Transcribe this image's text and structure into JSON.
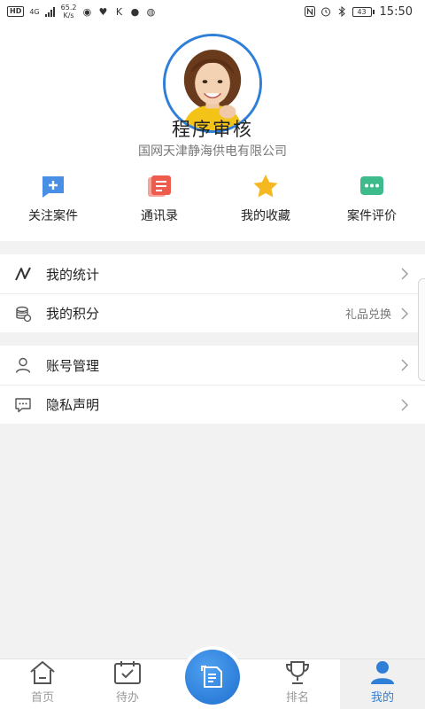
{
  "status_bar": {
    "left_chip": "HD",
    "network": "4G",
    "speed_value": "65.2",
    "speed_unit": "K/s",
    "battery": "43",
    "time": "15:50"
  },
  "profile": {
    "name": "程序审核",
    "company": "国网天津静海供电有限公司"
  },
  "quick_actions": [
    {
      "label": "关注案件",
      "icon": "bookmark-plus-icon",
      "color": "#4a8fe6"
    },
    {
      "label": "通讯录",
      "icon": "contacts-book-icon",
      "color": "#ee5c4d"
    },
    {
      "label": "我的收藏",
      "icon": "star-icon",
      "color": "#f5b820"
    },
    {
      "label": "案件评价",
      "icon": "comment-dots-icon",
      "color": "#3dbb8b"
    }
  ],
  "menu": {
    "statistics": {
      "label": "我的统计",
      "icon": "trend-line-icon"
    },
    "points": {
      "label": "我的积分",
      "extra": "礼品兑换",
      "icon": "coin-stack-icon"
    },
    "account": {
      "label": "账号管理",
      "icon": "user-icon"
    },
    "privacy": {
      "label": "隐私声明",
      "icon": "chat-bubble-icon"
    }
  },
  "tabs": [
    {
      "label": "首页",
      "icon": "home-icon"
    },
    {
      "label": "待办",
      "icon": "calendar-check-icon"
    },
    {
      "label": "",
      "icon": "document-scan-icon"
    },
    {
      "label": "排名",
      "icon": "trophy-icon"
    },
    {
      "label": "我的",
      "icon": "person-icon"
    }
  ],
  "colors": {
    "accent": "#2f7fd8",
    "background": "#f2f2f2"
  }
}
